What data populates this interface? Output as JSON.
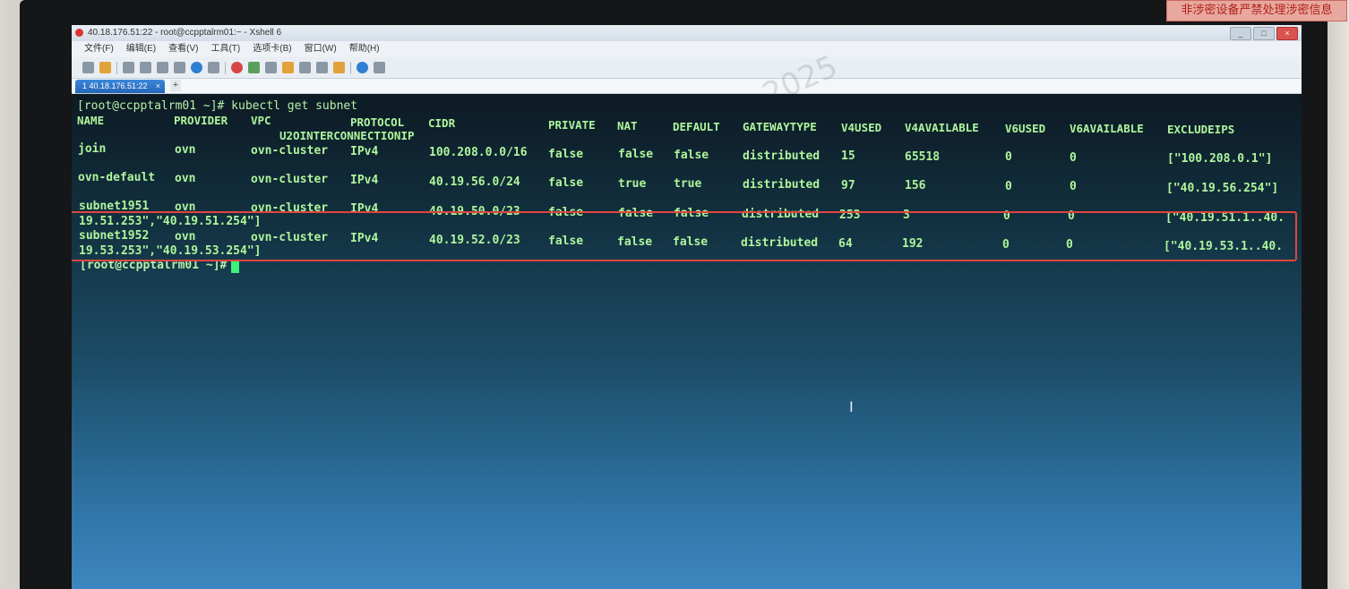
{
  "sticker": "非涉密设备严禁处理涉密信息",
  "window": {
    "title": "40.18.176.51:22 - root@ccpptalrm01:~ - Xshell 6",
    "controls": [
      "_",
      "□",
      "×"
    ]
  },
  "menu": [
    "文件(F)",
    "编辑(E)",
    "查看(V)",
    "工具(T)",
    "选项卡(B)",
    "窗口(W)",
    "帮助(H)"
  ],
  "tabs": [
    {
      "label": "1 40.18.176.51:22",
      "close": "×"
    }
  ],
  "tab_add": "+",
  "watermark": "2025",
  "terminal": {
    "command_line": "[root@ccpptalrm01 ~]# kubectl get subnet",
    "headers": {
      "name": "NAME",
      "provider": "PROVIDER",
      "vpc": "VPC",
      "protocol": "PROTOCOL",
      "u2o": "U2OINTERCONNECTIONIP",
      "cidr": "CIDR",
      "private": "PRIVATE",
      "nat": "NAT",
      "default": "DEFAULT",
      "gatewaytype": "GATEWAYTYPE",
      "v4used": "V4USED",
      "v4available": "V4AVAILABLE",
      "v6used": "V6USED",
      "v6available": "V6AVAILABLE",
      "excludeips": "EXCLUDEIPS"
    },
    "rows": [
      {
        "name": "join",
        "provider": "ovn",
        "vpc": "ovn-cluster",
        "protocol": "IPv4",
        "cidr": "100.208.0.0/16",
        "private": "false",
        "nat": "false",
        "default": "false",
        "gatewaytype": "distributed",
        "v4used": "15",
        "v4available": "65518",
        "v6used": "0",
        "v6available": "0",
        "excludeips": "[\"100.208.0.1\"]",
        "wrap": ""
      },
      {
        "name": "ovn-default",
        "provider": "ovn",
        "vpc": "ovn-cluster",
        "protocol": "IPv4",
        "cidr": "40.19.56.0/24",
        "private": "false",
        "nat": "true",
        "default": "true",
        "gatewaytype": "distributed",
        "v4used": "97",
        "v4available": "156",
        "v6used": "0",
        "v6available": "0",
        "excludeips": "[\"40.19.56.254\"]",
        "wrap": ""
      },
      {
        "name": "subnet1951",
        "provider": "ovn",
        "vpc": "ovn-cluster",
        "protocol": "IPv4",
        "cidr": "40.19.50.0/23",
        "private": "false",
        "nat": "false",
        "default": "false",
        "gatewaytype": "distributed",
        "v4used": "253",
        "v4available": "3",
        "v6used": "0",
        "v6available": "0",
        "excludeips": "[\"40.19.51.1..40.",
        "wrap": "19.51.253\",\"40.19.51.254\"]"
      },
      {
        "name": "subnet1952",
        "provider": "ovn",
        "vpc": "ovn-cluster",
        "protocol": "IPv4",
        "cidr": "40.19.52.0/23",
        "private": "false",
        "nat": "false",
        "default": "false",
        "gatewaytype": "distributed",
        "v4used": "64",
        "v4available": "192",
        "v6used": "0",
        "v6available": "0",
        "excludeips": "[\"40.19.53.1..40.",
        "wrap": "19.53.253\",\"40.19.53.254\"]"
      }
    ],
    "prompt": "[root@ccpptalrm01 ~]#"
  },
  "colors": {
    "terminal_text": "#aef59c",
    "highlight_box": "#e0453d",
    "cursor": "#3df27c"
  },
  "icons": [
    "new-session-icon",
    "open-folder-icon",
    "link-icon",
    "properties-icon",
    "search-icon",
    "transfer-icon",
    "globe-icon",
    "tools-icon",
    "xftp-icon",
    "refresh-icon",
    "fullscreen-icon",
    "lock-icon",
    "keyboard-icon",
    "script-icon",
    "layout-icon",
    "help-icon",
    "chat-icon"
  ]
}
